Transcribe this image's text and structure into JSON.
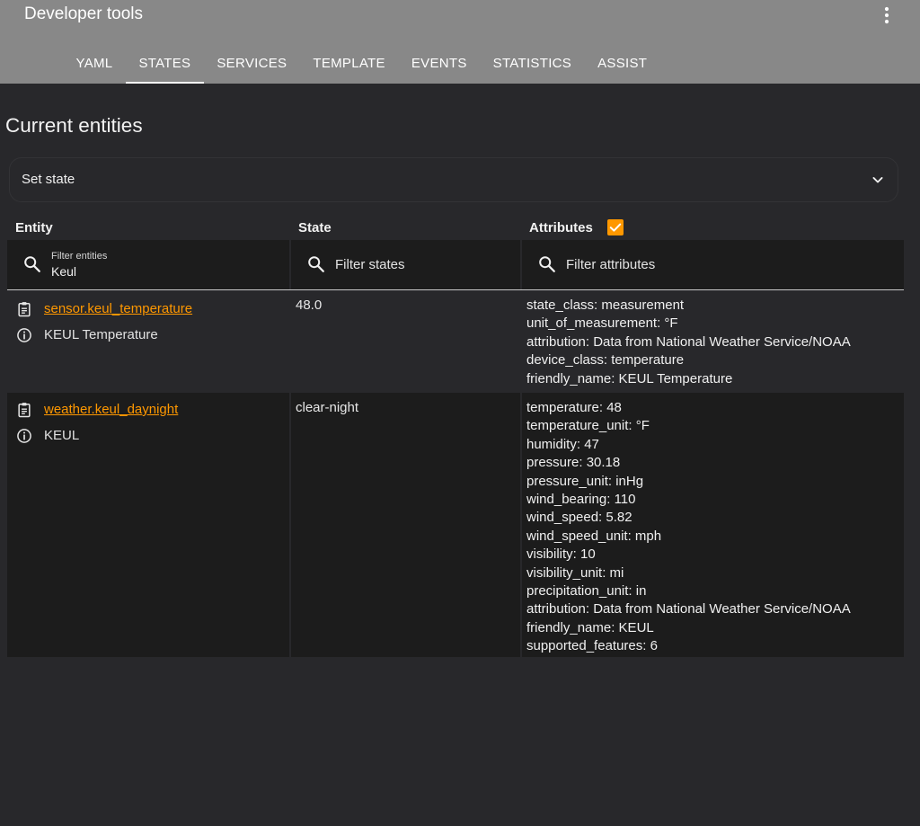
{
  "app": {
    "title": "Developer tools",
    "menu_icon": "more-vert-icon"
  },
  "tabs": [
    {
      "label": "YAML",
      "active": false
    },
    {
      "label": "STATES",
      "active": true
    },
    {
      "label": "SERVICES",
      "active": false
    },
    {
      "label": "TEMPLATE",
      "active": false
    },
    {
      "label": "EVENTS",
      "active": false
    },
    {
      "label": "STATISTICS",
      "active": false
    },
    {
      "label": "ASSIST",
      "active": false
    }
  ],
  "page": {
    "title": "Current entities",
    "set_state_label": "Set state"
  },
  "columns": {
    "entity": "Entity",
    "state": "State",
    "attributes": "Attributes",
    "attributes_checked": true
  },
  "filters": {
    "entity_label": "Filter entities",
    "entity_value": "Keul",
    "states_placeholder": "Filter states",
    "attributes_placeholder": "Filter attributes"
  },
  "colors": {
    "accent": "#ff9800",
    "header_bar": "#888888",
    "background": "#28282b",
    "row_alt": "#1c1c1c"
  },
  "rows": [
    {
      "entity_id": "sensor.keul_temperature",
      "friendly_name": "KEUL Temperature",
      "state": "48.0",
      "attributes": [
        "state_class: measurement",
        "unit_of_measurement: °F",
        "attribution: Data from National Weather Service/NOAA",
        "device_class: temperature",
        "friendly_name: KEUL Temperature"
      ]
    },
    {
      "entity_id": "weather.keul_daynight",
      "friendly_name": "KEUL",
      "state": "clear-night",
      "attributes": [
        "temperature: 48",
        "temperature_unit: °F",
        "humidity: 47",
        "pressure: 30.18",
        "pressure_unit: inHg",
        "wind_bearing: 110",
        "wind_speed: 5.82",
        "wind_speed_unit: mph",
        "visibility: 10",
        "visibility_unit: mi",
        "precipitation_unit: in",
        "attribution: Data from National Weather Service/NOAA",
        "friendly_name: KEUL",
        "supported_features: 6"
      ]
    }
  ]
}
